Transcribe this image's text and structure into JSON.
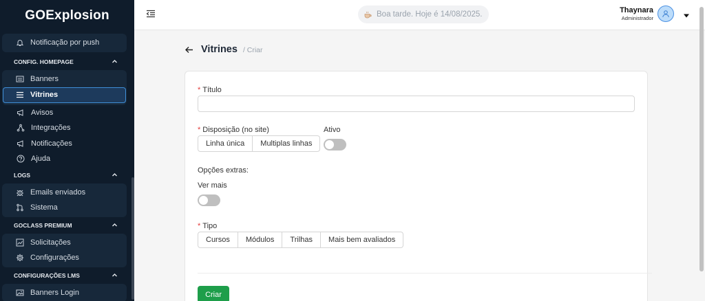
{
  "brand": {
    "logo_prefix": "GO",
    "logo_suffix": "Explosion"
  },
  "sidebar": {
    "top_group": [
      {
        "label": "Notificação por push",
        "icon": "bell-icon"
      }
    ],
    "sections": [
      {
        "title": "CONFIG. HOMEPAGE",
        "group_items": [
          {
            "label": "Banners",
            "icon": "banners-icon"
          },
          {
            "label": "Vitrines",
            "icon": "vitrines-icon",
            "active": true
          }
        ],
        "plain_items": [
          {
            "label": "Avisos",
            "icon": "megaphone-icon"
          },
          {
            "label": "Integrações",
            "icon": "integration-icon"
          },
          {
            "label": "Notificações",
            "icon": "megaphone-icon"
          },
          {
            "label": "Ajuda",
            "icon": "help-icon"
          }
        ]
      },
      {
        "title": "LOGS",
        "group_items": [
          {
            "label": "Emails enviados",
            "icon": "bug-icon"
          },
          {
            "label": "Sistema",
            "icon": "branch-icon"
          }
        ]
      },
      {
        "title": "GOCLASS PREMIUM",
        "group_items": [
          {
            "label": "Solicitações",
            "icon": "chart-icon"
          },
          {
            "label": "Configurações",
            "icon": "gear-icon"
          }
        ]
      },
      {
        "title": "CONFIGURAÇÕES LMS",
        "group_items": [
          {
            "label": "Banners Login",
            "icon": "image-icon"
          }
        ]
      }
    ]
  },
  "header": {
    "greeting": "Boa tarde. Hoje é 14/08/2025.",
    "user_name": "Thaynara",
    "user_role": "Administrador"
  },
  "page": {
    "title": "Vitrines",
    "breadcrumb": "/ Criar"
  },
  "form": {
    "titulo_label": "Título",
    "titulo_value": "",
    "disposicao_label": "Disposição (no site)",
    "disposicao_options": [
      "Linha única",
      "Multiplas linhas"
    ],
    "ativo_label": "Ativo",
    "ativo_on": false,
    "opcoes_extras_label": "Opções extras:",
    "ver_mais_label": "Ver mais",
    "ver_mais_on": false,
    "tipo_label": "Tipo",
    "tipo_options": [
      "Cursos",
      "Módulos",
      "Trilhas",
      "Mais bem avaliados"
    ],
    "submit_label": "Criar"
  },
  "colors": {
    "sidebar_bg": "#0f1c2b",
    "active_border": "#3f8fd8",
    "primary_button": "#1e9e4a",
    "required_mark": "#e23b3b"
  }
}
